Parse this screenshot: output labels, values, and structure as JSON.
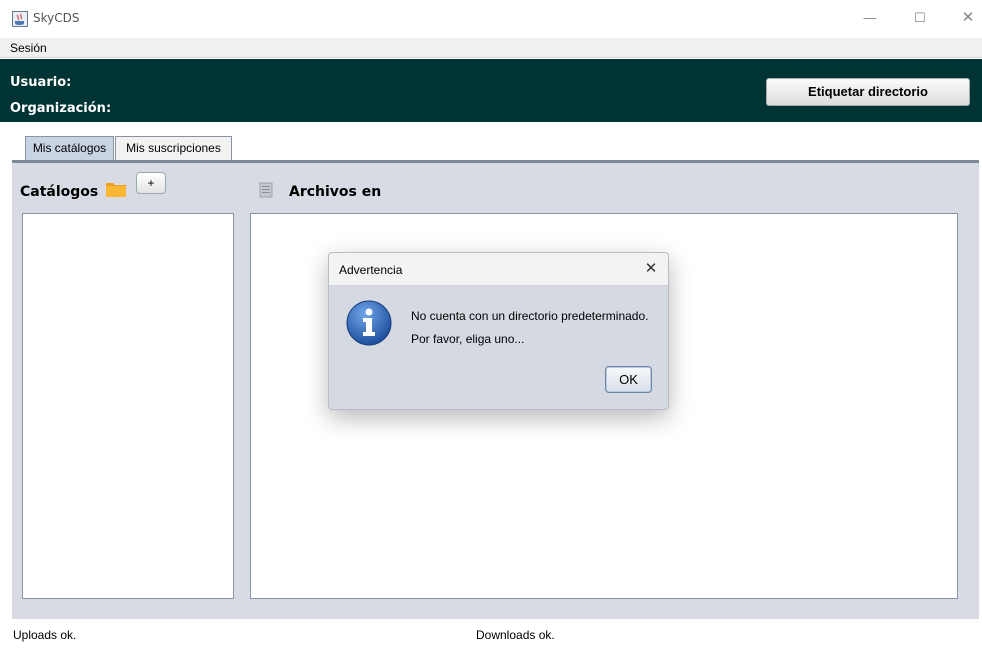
{
  "window": {
    "title": "SkyCDS",
    "icon": "java-icon",
    "controls": {
      "minimize": "—",
      "maximize": "☐",
      "close": "✕"
    }
  },
  "menubar": {
    "items": [
      "Sesión"
    ]
  },
  "header": {
    "usuario_label": "Usuario:",
    "organizacion_label": "Organización:",
    "tag_button": "Etiquetar directorio",
    "background": "#003333"
  },
  "tabs": [
    {
      "label": "Mis catálogos",
      "selected": true
    },
    {
      "label": "Mis suscripciones",
      "selected": false
    }
  ],
  "catalogs": {
    "title": "Catálogos",
    "add_button": "+",
    "folder_icon": "folder-icon",
    "items": []
  },
  "files": {
    "title": "Archivos en",
    "icon": "document-icon",
    "items": []
  },
  "status": {
    "uploads": "Uploads ok.",
    "downloads": "Downloads ok."
  },
  "dialog": {
    "title": "Advertencia",
    "close": "✕",
    "icon": "info-icon",
    "line1": "No cuenta con un directorio predeterminado.",
    "line2": "Por favor, eliga uno...",
    "ok_button": "OK"
  }
}
